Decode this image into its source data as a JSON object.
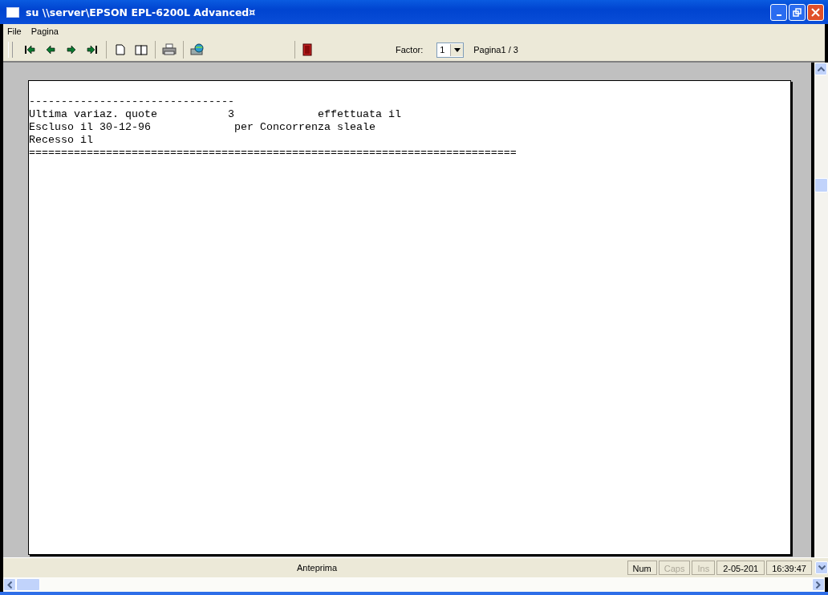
{
  "window": {
    "title": "su \\\\server\\EPSON EPL-6200L Advanced¤"
  },
  "menu": [
    "File",
    "Pagina"
  ],
  "toolbar": {
    "factor_label": "Factor:",
    "factor_value": "1",
    "page_label": "Pagina1 / 3"
  },
  "document": {
    "lines": [
      "--------------------------------",
      "Ultima variaz. quote           3             effettuata il",
      "Escluso il 30-12-96             per Concorrenza sleale",
      "Recesso il",
      "============================================================================"
    ]
  },
  "status_bar": {
    "message": "Anteprima",
    "indicators": [
      {
        "label": "Num",
        "on": true
      },
      {
        "label": "Caps",
        "on": false
      },
      {
        "label": "Ins",
        "on": false
      }
    ],
    "date": "2-05-201",
    "time": "16:39:47"
  }
}
